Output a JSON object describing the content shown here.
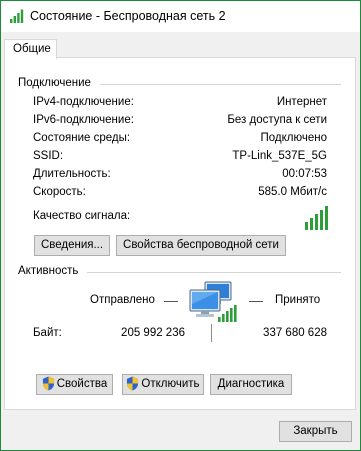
{
  "window": {
    "title": "Состояние - Беспроводная сеть 2",
    "tab": "Общие"
  },
  "connection": {
    "group_title": "Подключение",
    "rows": [
      {
        "label": "IPv4-подключение:",
        "value": "Интернет"
      },
      {
        "label": "IPv6-подключение:",
        "value": "Без доступа к сети"
      },
      {
        "label": "Состояние среды:",
        "value": "Подключено"
      },
      {
        "label": "SSID:",
        "value": "TP-Link_537E_5G"
      },
      {
        "label": "Длительность:",
        "value": "00:07:53"
      },
      {
        "label": "Скорость:",
        "value": "585.0 Мбит/с"
      }
    ],
    "signal_label": "Качество сигнала:",
    "signal_bars": 5,
    "details_button": "Сведения...",
    "wireless_props_button": "Свойства беспроводной сети"
  },
  "activity": {
    "group_title": "Активность",
    "sent_label": "Отправлено",
    "received_label": "Принято",
    "bytes_label": "Байт:",
    "bytes_sent": "205 992 236",
    "bytes_received": "337 680 628"
  },
  "actions": {
    "properties_button": "Свойства",
    "disable_button": "Отключить",
    "diagnostics_button": "Диагностика"
  },
  "footer": {
    "close_button": "Закрыть"
  },
  "colors": {
    "signal": "#2e9e3b",
    "window_border": "#1c8a3a"
  },
  "icons": {
    "title": "wireless-network-icon",
    "activity": "network-computers-icon",
    "shield": "uac-shield-icon"
  }
}
